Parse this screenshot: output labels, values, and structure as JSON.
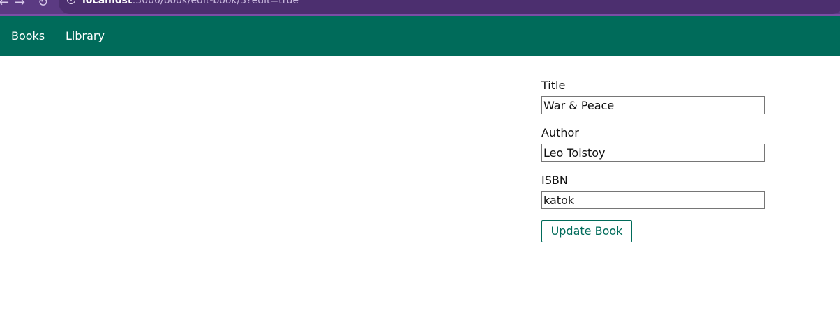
{
  "browser": {
    "url_host": "localhost",
    "url_rest": ":3000/book/edit-book/3?edit=true",
    "back_icon": "back-arrow-icon",
    "forward_icon": "forward-arrow-icon",
    "reload_icon": "reload-icon",
    "info_icon": "info-icon"
  },
  "navbar": {
    "books_label": "Books",
    "library_label": "Library",
    "background": "#006b5a"
  },
  "form": {
    "title_label": "Title",
    "title_value": "War & Peace",
    "author_label": "Author",
    "author_value": "Leo Tolstoy",
    "isbn_label": "ISBN",
    "isbn_value": "katok",
    "submit_label": "Update Book"
  }
}
